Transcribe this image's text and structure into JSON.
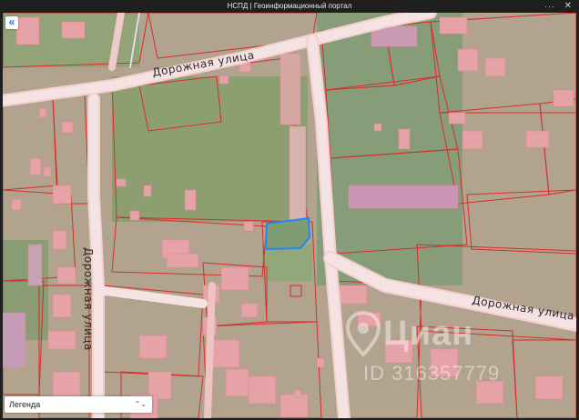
{
  "window": {
    "title": "НСПД | Геоинформационный портал",
    "menu_glyph": "···",
    "close_glyph": "✕"
  },
  "map": {
    "streets": [
      {
        "name": "Дорожная улица"
      },
      {
        "name": "Дорожная улица"
      },
      {
        "name": "Дорожная улица"
      }
    ],
    "selected_parcel_color": "#1e88ff",
    "parcel_border_color": "#d92c2c"
  },
  "controls": {
    "back_glyph": "«",
    "legend_label": "Легенда",
    "legend_chevron": "⌃⌄"
  },
  "watermark": {
    "brand": "Циан",
    "listing_id": "ID 316357779"
  },
  "icons": {
    "back": "chevron-double-left-icon",
    "menu": "more-dots-icon",
    "close": "close-icon",
    "legend": "select-chevron-icon",
    "watermark": "location-pin-icon"
  }
}
